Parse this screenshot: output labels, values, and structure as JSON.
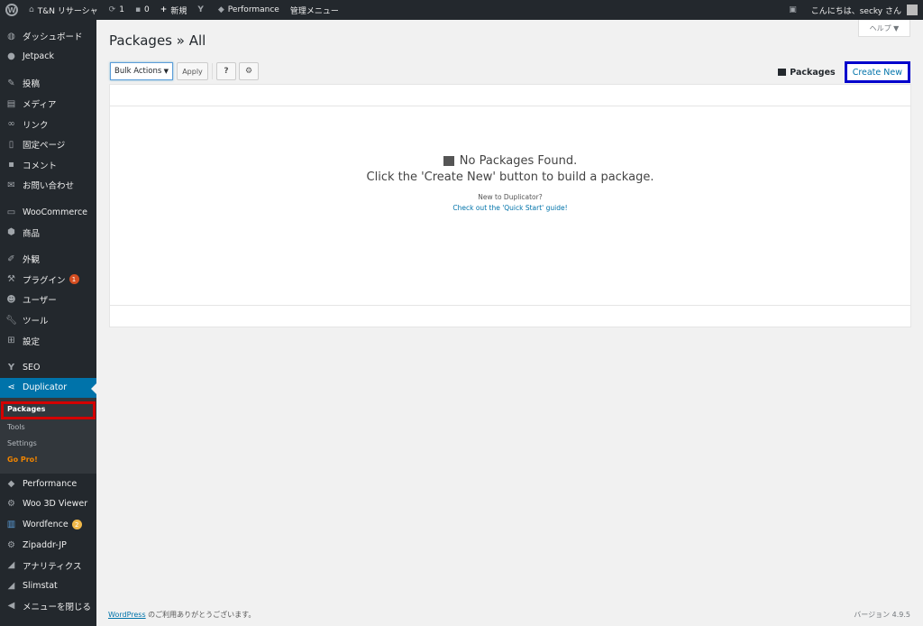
{
  "adminbar": {
    "site_name": "T&N リサーシャ",
    "updates_count": "1",
    "comments_count": "0",
    "new_label": "新規",
    "performance_label": "Performance",
    "admin_menu_label": "管理メニュー",
    "greeting": "こんにちは、secky さん"
  },
  "sidebar": {
    "items": [
      {
        "label": "ダッシュボード",
        "icon": "dashboard-icon"
      },
      {
        "label": "Jetpack",
        "icon": "jetpack-icon"
      },
      {
        "label": "投稿",
        "icon": "pin-icon"
      },
      {
        "label": "メディア",
        "icon": "media-icon"
      },
      {
        "label": "リンク",
        "icon": "link-icon"
      },
      {
        "label": "固定ページ",
        "icon": "page-icon"
      },
      {
        "label": "コメント",
        "icon": "comment-icon"
      },
      {
        "label": "お問い合わせ",
        "icon": "mail-icon"
      },
      {
        "label": "WooCommerce",
        "icon": "woo-icon"
      },
      {
        "label": "商品",
        "icon": "product-icon"
      },
      {
        "label": "外観",
        "icon": "appearance-icon"
      },
      {
        "label": "プラグイン",
        "icon": "plugin-icon",
        "badge": "1"
      },
      {
        "label": "ユーザー",
        "icon": "user-icon"
      },
      {
        "label": "ツール",
        "icon": "wrench-icon"
      },
      {
        "label": "設定",
        "icon": "settings-icon"
      },
      {
        "label": "SEO",
        "icon": "seo-icon"
      },
      {
        "label": "Duplicator",
        "icon": "share-icon"
      },
      {
        "label": "Performance",
        "icon": "performance-icon"
      },
      {
        "label": "Woo 3D Viewer",
        "icon": "gear-icon"
      },
      {
        "label": "Wordfence",
        "icon": "wordfence-icon",
        "badge": "2"
      },
      {
        "label": "Zipaddr-JP",
        "icon": "gear-icon"
      },
      {
        "label": "アナリティクス",
        "icon": "analytics-icon"
      },
      {
        "label": "Slimstat",
        "icon": "chart-icon"
      },
      {
        "label": "メニューを閉じる",
        "icon": "collapse-icon"
      }
    ],
    "submenu": {
      "packages": "Packages",
      "tools": "Tools",
      "settings": "Settings",
      "gopro": "Go Pro!"
    }
  },
  "main": {
    "help_label": "ヘルプ ▼",
    "title": "Packages » All",
    "bulk_actions": "Bulk Actions",
    "apply": "Apply",
    "packages_label": "Packages",
    "create_new": "Create New",
    "empty_title": "No Packages Found.",
    "empty_subtitle": "Click the 'Create New' button to build a package.",
    "new_to": "New to Duplicator?",
    "quick_start": "Check out the 'Quick Start' guide!"
  },
  "footer": {
    "wp_link": "WordPress",
    "thanks": " のご利用ありがとうございます。",
    "version": "バージョン 4.9.5"
  },
  "colors": {
    "accent": "#0073aa",
    "highlight_red": "#d40000",
    "highlight_blue": "#0000cc",
    "badge_red": "#d54e21",
    "badge_orange": "#f0b849",
    "gopro": "#f18500"
  }
}
